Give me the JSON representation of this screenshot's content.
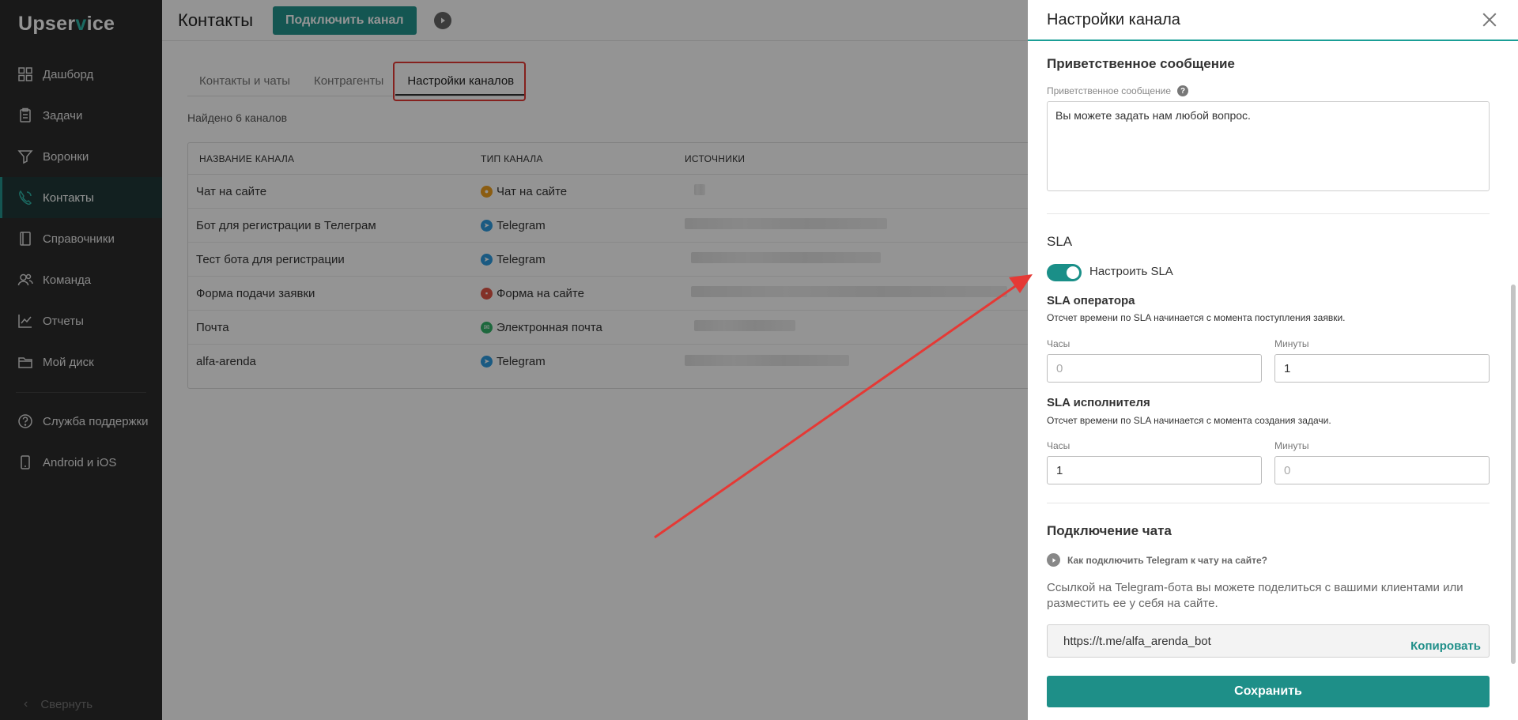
{
  "app": {
    "logo_prefix": "Upser",
    "logo_v": "v",
    "logo_suffix": "ice"
  },
  "sidebar": {
    "items": [
      {
        "label": "Дашборд",
        "icon": "dashboard-icon"
      },
      {
        "label": "Задачи",
        "icon": "tasks-icon"
      },
      {
        "label": "Воронки",
        "icon": "funnel-icon"
      },
      {
        "label": "Контакты",
        "icon": "contacts-icon",
        "active": true
      },
      {
        "label": "Справочники",
        "icon": "book-icon"
      },
      {
        "label": "Команда",
        "icon": "team-icon"
      },
      {
        "label": "Отчеты",
        "icon": "reports-icon"
      },
      {
        "label": "Мой диск",
        "icon": "folder-icon"
      }
    ],
    "support_label": "Служба поддержки",
    "mobile_label": "Android и iOS",
    "collapse_label": "Свернуть"
  },
  "header": {
    "title": "Контакты",
    "connect_button": "Подключить канал"
  },
  "tabs": [
    {
      "label": "Контакты и чаты"
    },
    {
      "label": "Контрагенты"
    },
    {
      "label": "Настройки каналов",
      "active": true
    }
  ],
  "found_text": "Найдено 6 каналов",
  "table": {
    "columns": [
      "НАЗВАНИЕ КАНАЛА",
      "ТИП КАНАЛА",
      "ИСТОЧНИКИ"
    ],
    "rows": [
      {
        "name": "Чат на сайте",
        "type": "Чат на сайте",
        "type_color": "#f0a020"
      },
      {
        "name": "Бот для регистрации в Телеграм",
        "type": "Telegram",
        "type_color": "#2e9be0"
      },
      {
        "name": "Тест бота для регистрации",
        "type": "Telegram",
        "type_color": "#2e9be0"
      },
      {
        "name": "Форма подачи заявки",
        "type": "Форма на сайте",
        "type_color": "#e25545"
      },
      {
        "name": "Почта",
        "type": "Электронная почта",
        "type_color": "#33b369"
      },
      {
        "name": "alfa-arenda",
        "type": "Telegram",
        "type_color": "#2e9be0"
      }
    ]
  },
  "panel": {
    "title": "Настройки канала",
    "greeting": {
      "section_title": "Приветственное сообщение",
      "field_label": "Приветственное сообщение",
      "value": "Вы можете задать нам любой вопрос."
    },
    "sla": {
      "section_title": "SLA",
      "toggle_label": "Настроить SLA",
      "toggle_on": true,
      "operator": {
        "title": "SLA оператора",
        "hint": "Отсчет времени по SLA начинается с момента поступления заявки.",
        "hours_label": "Часы",
        "hours_placeholder": "0",
        "minutes_label": "Минуты",
        "minutes_value": "1"
      },
      "executor": {
        "title": "SLA исполнителя",
        "hint": "Отсчет времени по SLA начинается с момента создания задачи.",
        "hours_label": "Часы",
        "hours_value": "1",
        "minutes_label": "Минуты",
        "minutes_placeholder": "0"
      }
    },
    "chat": {
      "section_title": "Подключение чата",
      "howto": "Как подключить Telegram к чату на сайте?",
      "description": "Ссылкой на Telegram-бота вы можете поделиться с вашими клиентами или разместить ее у себя на сайте.",
      "link": "https://t.me/alfa_arenda_bot",
      "copy_label": "Копировать"
    },
    "save_label": "Сохранить"
  },
  "colors": {
    "accent": "#1e8f88",
    "sidebar_bg": "#2b2b2b",
    "highlight": "#e53935"
  }
}
